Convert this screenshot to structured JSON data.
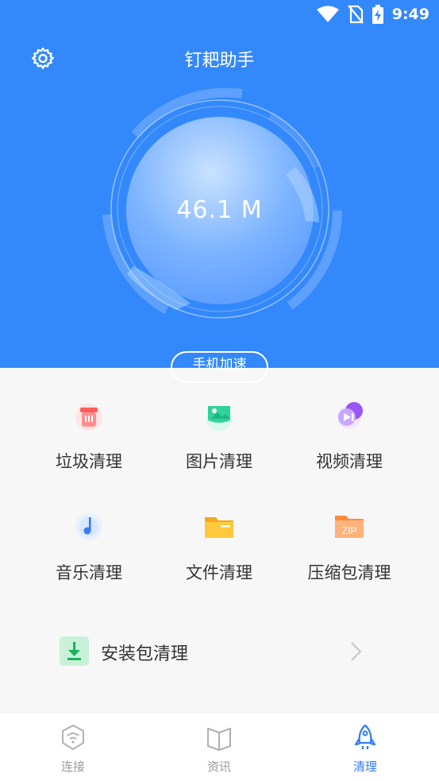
{
  "status_bar": {
    "time": "9:49"
  },
  "header": {
    "title": "钉耙助手",
    "cache_size": "46.1 M",
    "boost_button_label": "手机加速"
  },
  "features": [
    {
      "label": "垃圾清理",
      "icon": "trash-bin-icon"
    },
    {
      "label": "图片清理",
      "icon": "image-icon"
    },
    {
      "label": "视频清理",
      "icon": "video-play-icon"
    },
    {
      "label": "音乐清理",
      "icon": "music-note-icon"
    },
    {
      "label": "文件清理",
      "icon": "folder-icon"
    },
    {
      "label": "压缩包清理",
      "icon": "zip-archive-icon"
    }
  ],
  "apk_cleanup": {
    "label": "安装包清理",
    "icon": "download-package-icon"
  },
  "bottom_nav": {
    "items": [
      {
        "label": "连接",
        "icon": "wifi-shield-icon",
        "active": false
      },
      {
        "label": "资讯",
        "icon": "book-open-icon",
        "active": false
      },
      {
        "label": "清理",
        "icon": "rocket-icon",
        "active": true
      }
    ]
  },
  "colors": {
    "header_bg": "#3388fb",
    "accent": "#2f7dfa",
    "page_bg": "#f7f7f7"
  }
}
